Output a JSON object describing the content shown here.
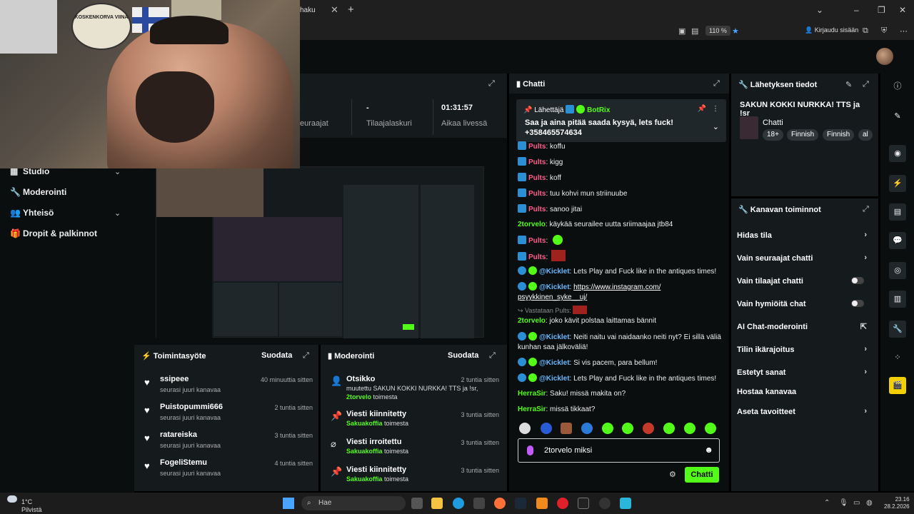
{
  "browser": {
    "tab_title": "haku",
    "zoom": "110 %",
    "login": "Kirjaudu sisään"
  },
  "webcam": {
    "sign_text": "KOSKENKORVA VIINA"
  },
  "stats": {
    "items": [
      {
        "value": "",
        "label": "euraajat"
      },
      {
        "value": "-",
        "label": "Tilaajalaskuri"
      },
      {
        "value": "01:31:57",
        "label": "Aikaa livessä"
      }
    ]
  },
  "nav": {
    "items": [
      {
        "label": "Studio"
      },
      {
        "label": "Moderointi"
      },
      {
        "label": "Yhteisö"
      },
      {
        "label": "Dropit & palkinnot"
      }
    ]
  },
  "activity": {
    "title": "Toimintasyöte",
    "filter": "Suodata",
    "rows": [
      {
        "name": "ssipeee",
        "sub": "seurasi juuri kanavaa",
        "time": "40 minuuttia sitten"
      },
      {
        "name": "Puistopummi666",
        "sub": "seurasi juuri kanavaa",
        "time": "2 tuntia sitten"
      },
      {
        "name": "ratareiska",
        "sub": "seurasi juuri kanavaa",
        "time": "3 tuntia sitten"
      },
      {
        "name": "FogeliStemu",
        "sub": "seurasi juuri kanavaa",
        "time": "4 tuntia sitten"
      }
    ]
  },
  "moderation": {
    "title": "Moderointi",
    "filter": "Suodata",
    "rows": [
      {
        "title": "Otsikko",
        "line1": "muutettu SAKUN KOKKI NURKKA! TTS ja !sr,",
        "user": "2torvelo",
        "action": "toimesta",
        "time": "2 tuntia sitten"
      },
      {
        "title": "Viesti kiinnitetty",
        "user": "Sakuakoffia",
        "action": "toimesta",
        "time": "3 tuntia sitten"
      },
      {
        "title": "Viesti irroitettu",
        "user": "Sakuakoffia",
        "action": "toimesta",
        "time": "3 tuntia sitten"
      },
      {
        "title": "Viesti kiinnitetty",
        "user": "Sakuakoffia",
        "action": "toimesta",
        "time": "3 tuntia sitten"
      }
    ]
  },
  "chat": {
    "title": "Chatti",
    "pinned": {
      "label": "Lähettäjä",
      "sender": "BotRix",
      "text": "Saa ja aina pitää saada kysyä, lets fuck! +358465574634"
    },
    "messages": [
      {
        "user": "Pults",
        "text": "koffu"
      },
      {
        "user": "Pults",
        "text": "kigg"
      },
      {
        "user": "Pults",
        "text": "koff"
      },
      {
        "user": "Pults",
        "text": "tuu kohvi mun striinuube"
      },
      {
        "user": "Pults",
        "text": "sanoo jitai"
      },
      {
        "user": "2torvelo",
        "text": "käykää seurailee uutta sriimaajaa jtb84"
      },
      {
        "user": "Pults",
        "text": ""
      },
      {
        "user": "Pults",
        "text": ""
      },
      {
        "user": "@Kicklet",
        "text": "Lets Play and Fuck like in the antiques times!"
      },
      {
        "user": "@Kicklet",
        "text": "",
        "link": "https://www.instagram.com/ psyykkinen_syke__uj/"
      },
      {
        "reply": "Vastataan Pults:"
      },
      {
        "user": "2torvelo",
        "text": "joko kävit polstaa laittamas bännit"
      },
      {
        "user": "@Kicklet",
        "text": "Neiti naitu vai naidaanko neiti nyt? Ei sillä väliä kunhan saa jälkoväliä!"
      },
      {
        "user": "@Kicklet",
        "text": "Si vis pacem, para bellum!"
      },
      {
        "user": "@Kicklet",
        "text": "Lets Play and Fuck like in the antiques times!"
      },
      {
        "user": "HerraSir",
        "text": "Saku! missä makita on?"
      },
      {
        "user": "HerraSir",
        "text": "missä tikkaat?"
      }
    ],
    "input_value": "2torvelo miksi",
    "send_label": "Chatti"
  },
  "stream_info": {
    "title": "Lähetyksen tiedot",
    "stream_title": "SAKUN KOKKI NURKKA! TTS ja !sr",
    "category": "Chatti",
    "tags": [
      "18+",
      "Finnish",
      "Finnish",
      "al"
    ]
  },
  "channel_actions": {
    "title": "Kanavan toiminnot",
    "items": [
      {
        "label": "Hidas tila",
        "kind": "chevron"
      },
      {
        "label": "Vain seuraajat chatti",
        "kind": "chevron"
      },
      {
        "label": "Vain tilaajat chatti",
        "kind": "toggle"
      },
      {
        "label": "Vain hymiöitä chat",
        "kind": "toggle"
      },
      {
        "label": "AI Chat-moderointi",
        "kind": "external"
      },
      {
        "label": "Tilin ikärajoitus",
        "kind": "chevron"
      },
      {
        "label": "Estetyt sanat",
        "kind": "chevron"
      },
      {
        "label": "Hostaa kanavaa",
        "kind": "none"
      },
      {
        "label": "Aseta tavoitteet",
        "kind": "chevron"
      }
    ]
  },
  "taskbar": {
    "temp": "1°C",
    "weather": "Pilvistä",
    "search": "Hae",
    "time": "23.16",
    "date": "28.2.2026"
  },
  "colors": {
    "accent": "#53fc18",
    "panel": "#151a1d",
    "background": "#0b0e0f"
  }
}
